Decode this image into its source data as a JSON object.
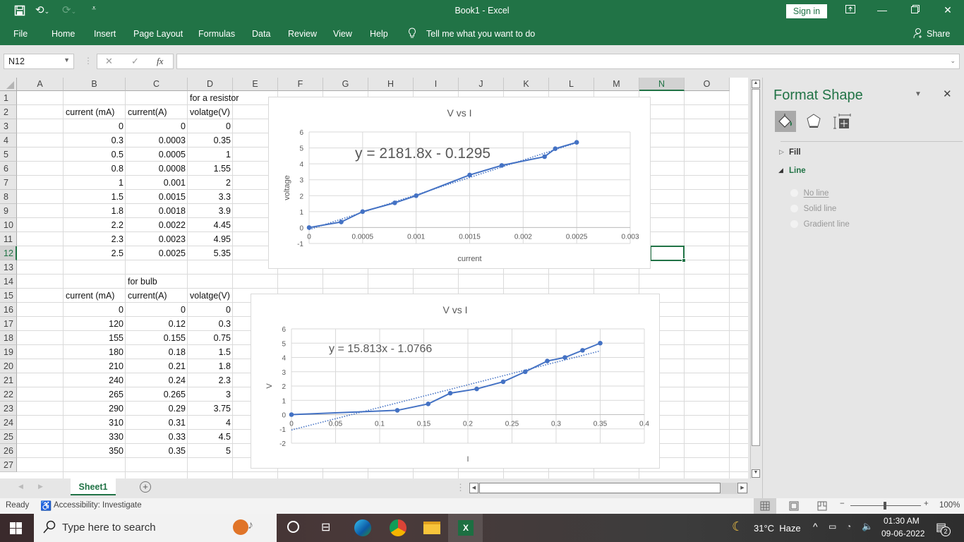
{
  "titlebar": {
    "title": "Book1  -  Excel",
    "sign_in": "Sign in",
    "icons": [
      "save-icon",
      "undo-icon",
      "redo-icon",
      "customize-qat-icon",
      "ribbon-display-icon",
      "minimize-icon",
      "restore-icon",
      "close-icon"
    ]
  },
  "ribbon": {
    "tabs": [
      "File",
      "Home",
      "Insert",
      "Page Layout",
      "Formulas",
      "Data",
      "Review",
      "View",
      "Help"
    ],
    "tell_me": "Tell me what you want to do",
    "share": "Share"
  },
  "formula_bar": {
    "name_box": "N12",
    "fx": "fx",
    "value": ""
  },
  "grid": {
    "columns": [
      "A",
      "B",
      "C",
      "D",
      "E",
      "F",
      "G",
      "H",
      "I",
      "J",
      "K",
      "L",
      "M",
      "N",
      "O"
    ],
    "selected_column": "N",
    "selected_row": "12",
    "rows": [
      "1",
      "2",
      "3",
      "4",
      "5",
      "6",
      "7",
      "8",
      "9",
      "10",
      "11",
      "12",
      "13",
      "14",
      "15",
      "16",
      "17",
      "18",
      "19",
      "20",
      "21",
      "22",
      "23",
      "24",
      "25",
      "26",
      "27"
    ],
    "resistor_label": "for a resistor",
    "bulb_label": "for bulb",
    "headers": [
      "current (mA)",
      "current(A)",
      "volatge(V)"
    ],
    "resistor_table": [
      [
        "0",
        "0",
        "0"
      ],
      [
        "0.3",
        "0.0003",
        "0.35"
      ],
      [
        "0.5",
        "0.0005",
        "1"
      ],
      [
        "0.8",
        "0.0008",
        "1.55"
      ],
      [
        "1",
        "0.001",
        "2"
      ],
      [
        "1.5",
        "0.0015",
        "3.3"
      ],
      [
        "1.8",
        "0.0018",
        "3.9"
      ],
      [
        "2.2",
        "0.0022",
        "4.45"
      ],
      [
        "2.3",
        "0.0023",
        "4.95"
      ],
      [
        "2.5",
        "0.0025",
        "5.35"
      ]
    ],
    "bulb_table": [
      [
        "0",
        "0",
        "0"
      ],
      [
        "120",
        "0.12",
        "0.3"
      ],
      [
        "155",
        "0.155",
        "0.75"
      ],
      [
        "180",
        "0.18",
        "1.5"
      ],
      [
        "210",
        "0.21",
        "1.8"
      ],
      [
        "240",
        "0.24",
        "2.3"
      ],
      [
        "265",
        "0.265",
        "3"
      ],
      [
        "290",
        "0.29",
        "3.75"
      ],
      [
        "310",
        "0.31",
        "4"
      ],
      [
        "330",
        "0.33",
        "4.5"
      ],
      [
        "350",
        "0.35",
        "5"
      ]
    ]
  },
  "chart_data": [
    {
      "type": "line",
      "title": "V vs I",
      "xlabel": "current",
      "ylabel": "voltage",
      "x": [
        0,
        0.0003,
        0.0005,
        0.0008,
        0.001,
        0.0015,
        0.0018,
        0.0022,
        0.0023,
        0.0025
      ],
      "series": [
        {
          "name": "voltage",
          "values": [
            0,
            0.35,
            1,
            1.55,
            2,
            3.3,
            3.9,
            4.45,
            4.95,
            5.35
          ]
        }
      ],
      "trendline": {
        "equation": "y = 2181.8x - 0.1295",
        "slope": 2181.8,
        "intercept": -0.1295
      },
      "xlim": [
        0,
        0.003
      ],
      "ylim": [
        -1,
        6
      ],
      "xticks": [
        "0",
        "0.0005",
        "0.001",
        "0.0015",
        "0.002",
        "0.0025",
        "0.003"
      ],
      "yticks": [
        "-1",
        "0",
        "1",
        "2",
        "3",
        "4",
        "5",
        "6"
      ],
      "grid": true,
      "color": "#4472c4"
    },
    {
      "type": "line",
      "title": "V vs I",
      "xlabel": "I",
      "ylabel": "V",
      "x": [
        0,
        0.12,
        0.155,
        0.18,
        0.21,
        0.24,
        0.265,
        0.29,
        0.31,
        0.33,
        0.35
      ],
      "series": [
        {
          "name": "V",
          "values": [
            0,
            0.3,
            0.75,
            1.5,
            1.8,
            2.3,
            3,
            3.75,
            4,
            4.5,
            5
          ]
        }
      ],
      "trendline": {
        "equation": "y = 15.813x - 1.0766",
        "slope": 15.813,
        "intercept": -1.0766
      },
      "xlim": [
        0,
        0.4
      ],
      "ylim": [
        -2,
        6
      ],
      "xticks": [
        "0",
        "0.05",
        "0.1",
        "0.15",
        "0.2",
        "0.25",
        "0.3",
        "0.35",
        "0.4"
      ],
      "yticks": [
        "-2",
        "-1",
        "0",
        "1",
        "2",
        "3",
        "4",
        "5",
        "6"
      ],
      "grid": true,
      "color": "#4472c4"
    }
  ],
  "format_pane": {
    "title": "Format Shape",
    "icons": [
      "fill-line-icon",
      "effects-icon",
      "size-properties-icon"
    ],
    "fill": "Fill",
    "line": "Line",
    "options": [
      "No line",
      "Solid line",
      "Gradient line"
    ]
  },
  "sheets": {
    "tabs": [
      "Sheet1"
    ],
    "active": "Sheet1"
  },
  "status": {
    "ready": "Ready",
    "accessibility": "Accessibility: Investigate",
    "zoom": "100%"
  },
  "taskbar": {
    "search_placeholder": "Type here to search",
    "weather": "31°C  Haze",
    "time": "01:30 AM",
    "date": "09-06-2022",
    "notifications": "2",
    "apps": [
      "cortana-icon",
      "task-view-icon",
      "edge-icon",
      "chrome-icon",
      "file-explorer-icon",
      "excel-icon"
    ]
  }
}
